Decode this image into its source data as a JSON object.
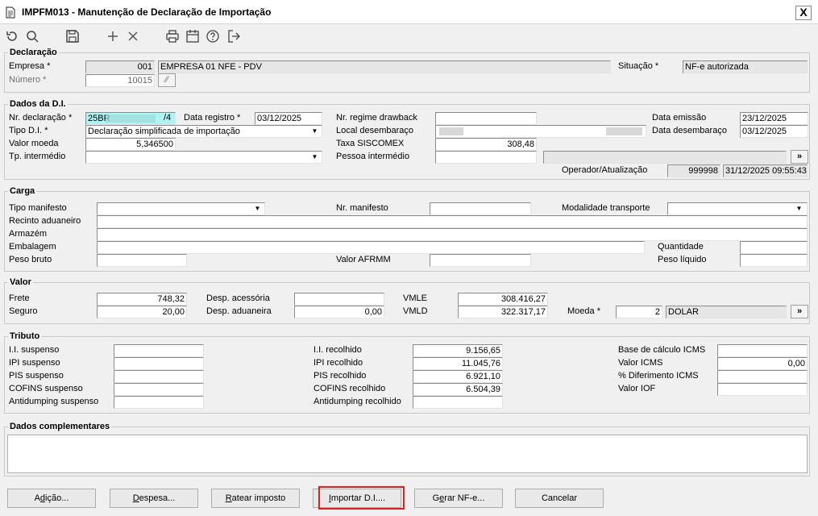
{
  "window": {
    "title": "IMPFM013 - Manutenção de Declaração de Importação",
    "close_label": "X"
  },
  "toolbar": {
    "icons": [
      "undo-icon",
      "search-icon",
      "save-icon",
      "add-icon",
      "delete-icon",
      "print-icon",
      "calendar-icon",
      "help-icon",
      "exit-icon"
    ]
  },
  "declaracao": {
    "legend": "Declaração",
    "empresa_label": "Empresa *",
    "empresa_code": "001",
    "empresa_name": "EMPRESA 01 NFE - PDV",
    "numero_label": "Número *",
    "numero_value": "10015",
    "situacao_label": "Situação *",
    "situacao_value": "NF-e autorizada"
  },
  "dados_di": {
    "legend": "Dados da D.I.",
    "nr_declaracao_label": "Nr. declaração *",
    "nr_declaracao_value": "25BR",
    "nr_declaracao_suffix": "/4",
    "data_registro_label": "Data registro *",
    "data_registro_value": "03/12/2025",
    "nr_regime_label": "Nr. regime drawback",
    "nr_regime_value": "",
    "data_emissao_label": "Data emissão",
    "data_emissao_value": "23/12/2025",
    "tipo_di_label": "Tipo D.I. *",
    "tipo_di_value": "Declaração simplificada de importação",
    "local_desembaraco_label": "Local desembaraço",
    "data_desembaraco_label": "Data desembaraço",
    "data_desembaraco_value": "03/12/2025",
    "valor_moeda_label": "Valor moeda",
    "valor_moeda_value": "5,346500",
    "taxa_siscomex_label": "Taxa SISCOMEX",
    "taxa_siscomex_value": "308,48",
    "tp_intermedio_label": "Tp. intermédio",
    "tp_intermedio_value": "",
    "pessoa_intermedio_label": "Pessoa intermédio",
    "pessoa_intermedio_value": "",
    "more_button": "»",
    "operador_label": "Operador/Atualização",
    "operador_value": "999998",
    "atualizacao_value": "31/12/2025 09:55:43"
  },
  "carga": {
    "legend": "Carga",
    "tipo_manifesto_label": "Tipo manifesto",
    "nr_manifesto_label": "Nr. manifesto",
    "modalidade_label": "Modalidade transporte",
    "recinto_label": "Recinto aduaneiro",
    "armazem_label": "Armazém",
    "embalagem_label": "Embalagem",
    "quantidade_label": "Quantidade",
    "peso_bruto_label": "Peso bruto",
    "valor_afrmm_label": "Valor AFRMM",
    "peso_liquido_label": "Peso líquido"
  },
  "valor": {
    "legend": "Valor",
    "frete_label": "Frete",
    "frete_value": "748,32",
    "seguro_label": "Seguro",
    "seguro_value": "20,00",
    "desp_acessoria_label": "Desp. acessória",
    "desp_acessoria_value": "",
    "desp_aduaneira_label": "Desp. aduaneira",
    "desp_aduaneira_value": "0,00",
    "vmle_label": "VMLE",
    "vmle_value": "308.416,27",
    "vmld_label": "VMLD",
    "vmld_value": "322.317,17",
    "moeda_label": "Moeda *",
    "moeda_code": "2",
    "moeda_name": "DOLAR",
    "more_button": "»"
  },
  "tributo": {
    "legend": "Tributo",
    "ii_suspenso_label": "I.I. suspenso",
    "ipi_suspenso_label": "IPI suspenso",
    "pis_suspenso_label": "PIS suspenso",
    "cofins_suspenso_label": "COFINS suspenso",
    "antidumping_suspenso_label": "Antidumping suspenso",
    "ii_recolhido_label": "I.I. recolhido",
    "ii_recolhido_value": "9.156,65",
    "ipi_recolhido_label": "IPI recolhido",
    "ipi_recolhido_value": "11.045,76",
    "pis_recolhido_label": "PIS recolhido",
    "pis_recolhido_value": "6.921,10",
    "cofins_recolhido_label": "COFINS recolhido",
    "cofins_recolhido_value": "6.504,39",
    "antidumping_recolhido_label": "Antidumping recolhido",
    "base_icms_label": "Base de cálculo ICMS",
    "valor_icms_label": "Valor ICMS",
    "valor_icms_value": "0,00",
    "diferimento_label": "% Diferimento ICMS",
    "valor_iof_label": "Valor IOF"
  },
  "complementares": {
    "legend": "Dados complementares",
    "value": ""
  },
  "buttons": {
    "adicao_first": "A",
    "adicao_ul": "d",
    "adicao_rest": "ição...",
    "despesa_ul": "D",
    "despesa_rest": "espesa...",
    "ratear_ul": "R",
    "ratear_rest": "atear imposto",
    "importar_ul": "I",
    "importar_rest": "mportar D.I....",
    "gerar_first": "G",
    "gerar_ul": "e",
    "gerar_rest": "rar NF-e...",
    "cancelar": "Cancelar"
  }
}
